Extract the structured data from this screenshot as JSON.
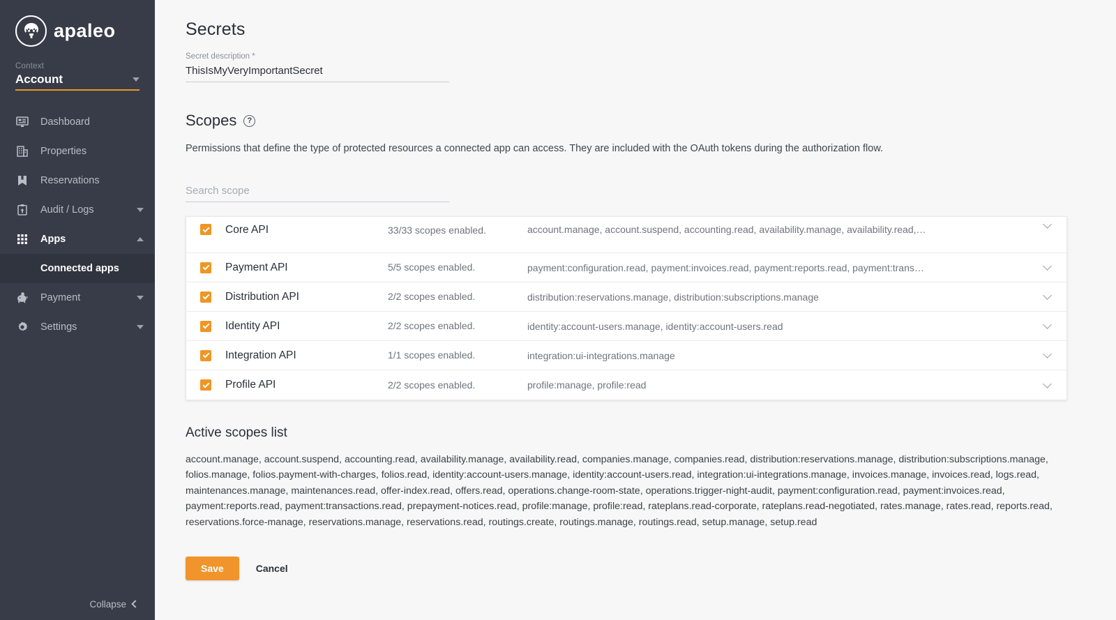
{
  "brand": {
    "name": "apaleo",
    "accent": "#f0942b",
    "sidebar_bg": "#373c48"
  },
  "sidebar": {
    "context_label": "Context",
    "context_value": "Account",
    "items": [
      {
        "label": "Dashboard",
        "icon": "monitor-icon",
        "expandable": false,
        "active": false
      },
      {
        "label": "Properties",
        "icon": "building-icon",
        "expandable": false,
        "active": false
      },
      {
        "label": "Reservations",
        "icon": "bookmark-icon",
        "expandable": false,
        "active": false
      },
      {
        "label": "Audit / Logs",
        "icon": "clipboard-icon",
        "expandable": true,
        "active": false
      },
      {
        "label": "Apps",
        "icon": "grid-icon",
        "expandable": true,
        "active": true
      },
      {
        "label": "Payment",
        "icon": "piggy-bank-icon",
        "expandable": true,
        "active": false
      },
      {
        "label": "Settings",
        "icon": "gear-icon",
        "expandable": true,
        "active": false
      }
    ],
    "sub_item": {
      "label": "Connected apps",
      "active": true
    },
    "collapse_label": "Collapse"
  },
  "main": {
    "secrets_title": "Secrets",
    "secret_description_label": "Secret description *",
    "secret_description_value": "ThisIsMyVeryImportantSecret",
    "scopes_title": "Scopes",
    "help_icon_glyph": "?",
    "scopes_description": "Permissions that define the type of protected resources a connected app can access. They are included with the OAuth tokens during the authorization flow.",
    "search_placeholder": "Search scope",
    "scope_rows": [
      {
        "name": "Core API",
        "count_text": "33/33 scopes enabled.",
        "scopes_preview": "account.manage, account.suspend, accounting.read, availability.manage, availability.read,…",
        "checked": true
      },
      {
        "name": "Payment API",
        "count_text": "5/5 scopes enabled.",
        "scopes_preview": "payment:configuration.read, payment:invoices.read, payment:reports.read, payment:trans…",
        "checked": true
      },
      {
        "name": "Distribution API",
        "count_text": "2/2 scopes enabled.",
        "scopes_preview": "distribution:reservations.manage, distribution:subscriptions.manage",
        "checked": true
      },
      {
        "name": "Identity API",
        "count_text": "2/2 scopes enabled.",
        "scopes_preview": "identity:account-users.manage, identity:account-users.read",
        "checked": true
      },
      {
        "name": "Integration API",
        "count_text": "1/1 scopes enabled.",
        "scopes_preview": "integration:ui-integrations.manage",
        "checked": true
      },
      {
        "name": "Profile API",
        "count_text": "2/2 scopes enabled.",
        "scopes_preview": "profile:manage, profile:read",
        "checked": true
      }
    ],
    "active_scopes_title": "Active scopes list",
    "active_scopes_text": "account.manage, account.suspend, accounting.read, availability.manage, availability.read, companies.manage, companies.read, distribution:reservations.manage, distribution:subscriptions.manage, folios.manage, folios.payment-with-charges, folios.read, identity:account-users.manage, identity:account-users.read, integration:ui-integrations.manage, invoices.manage, invoices.read, logs.read, maintenances.manage, maintenances.read, offer-index.read, offers.read, operations.change-room-state, operations.trigger-night-audit, payment:configuration.read, payment:invoices.read, payment:reports.read, payment:transactions.read, prepayment-notices.read, profile:manage, profile:read, rateplans.read-corporate, rateplans.read-negotiated, rates.manage, rates.read, reports.read, reservations.force-manage, reservations.manage, reservations.read, routings.create, routings.manage, routings.read, setup.manage, setup.read",
    "save_label": "Save",
    "cancel_label": "Cancel"
  }
}
